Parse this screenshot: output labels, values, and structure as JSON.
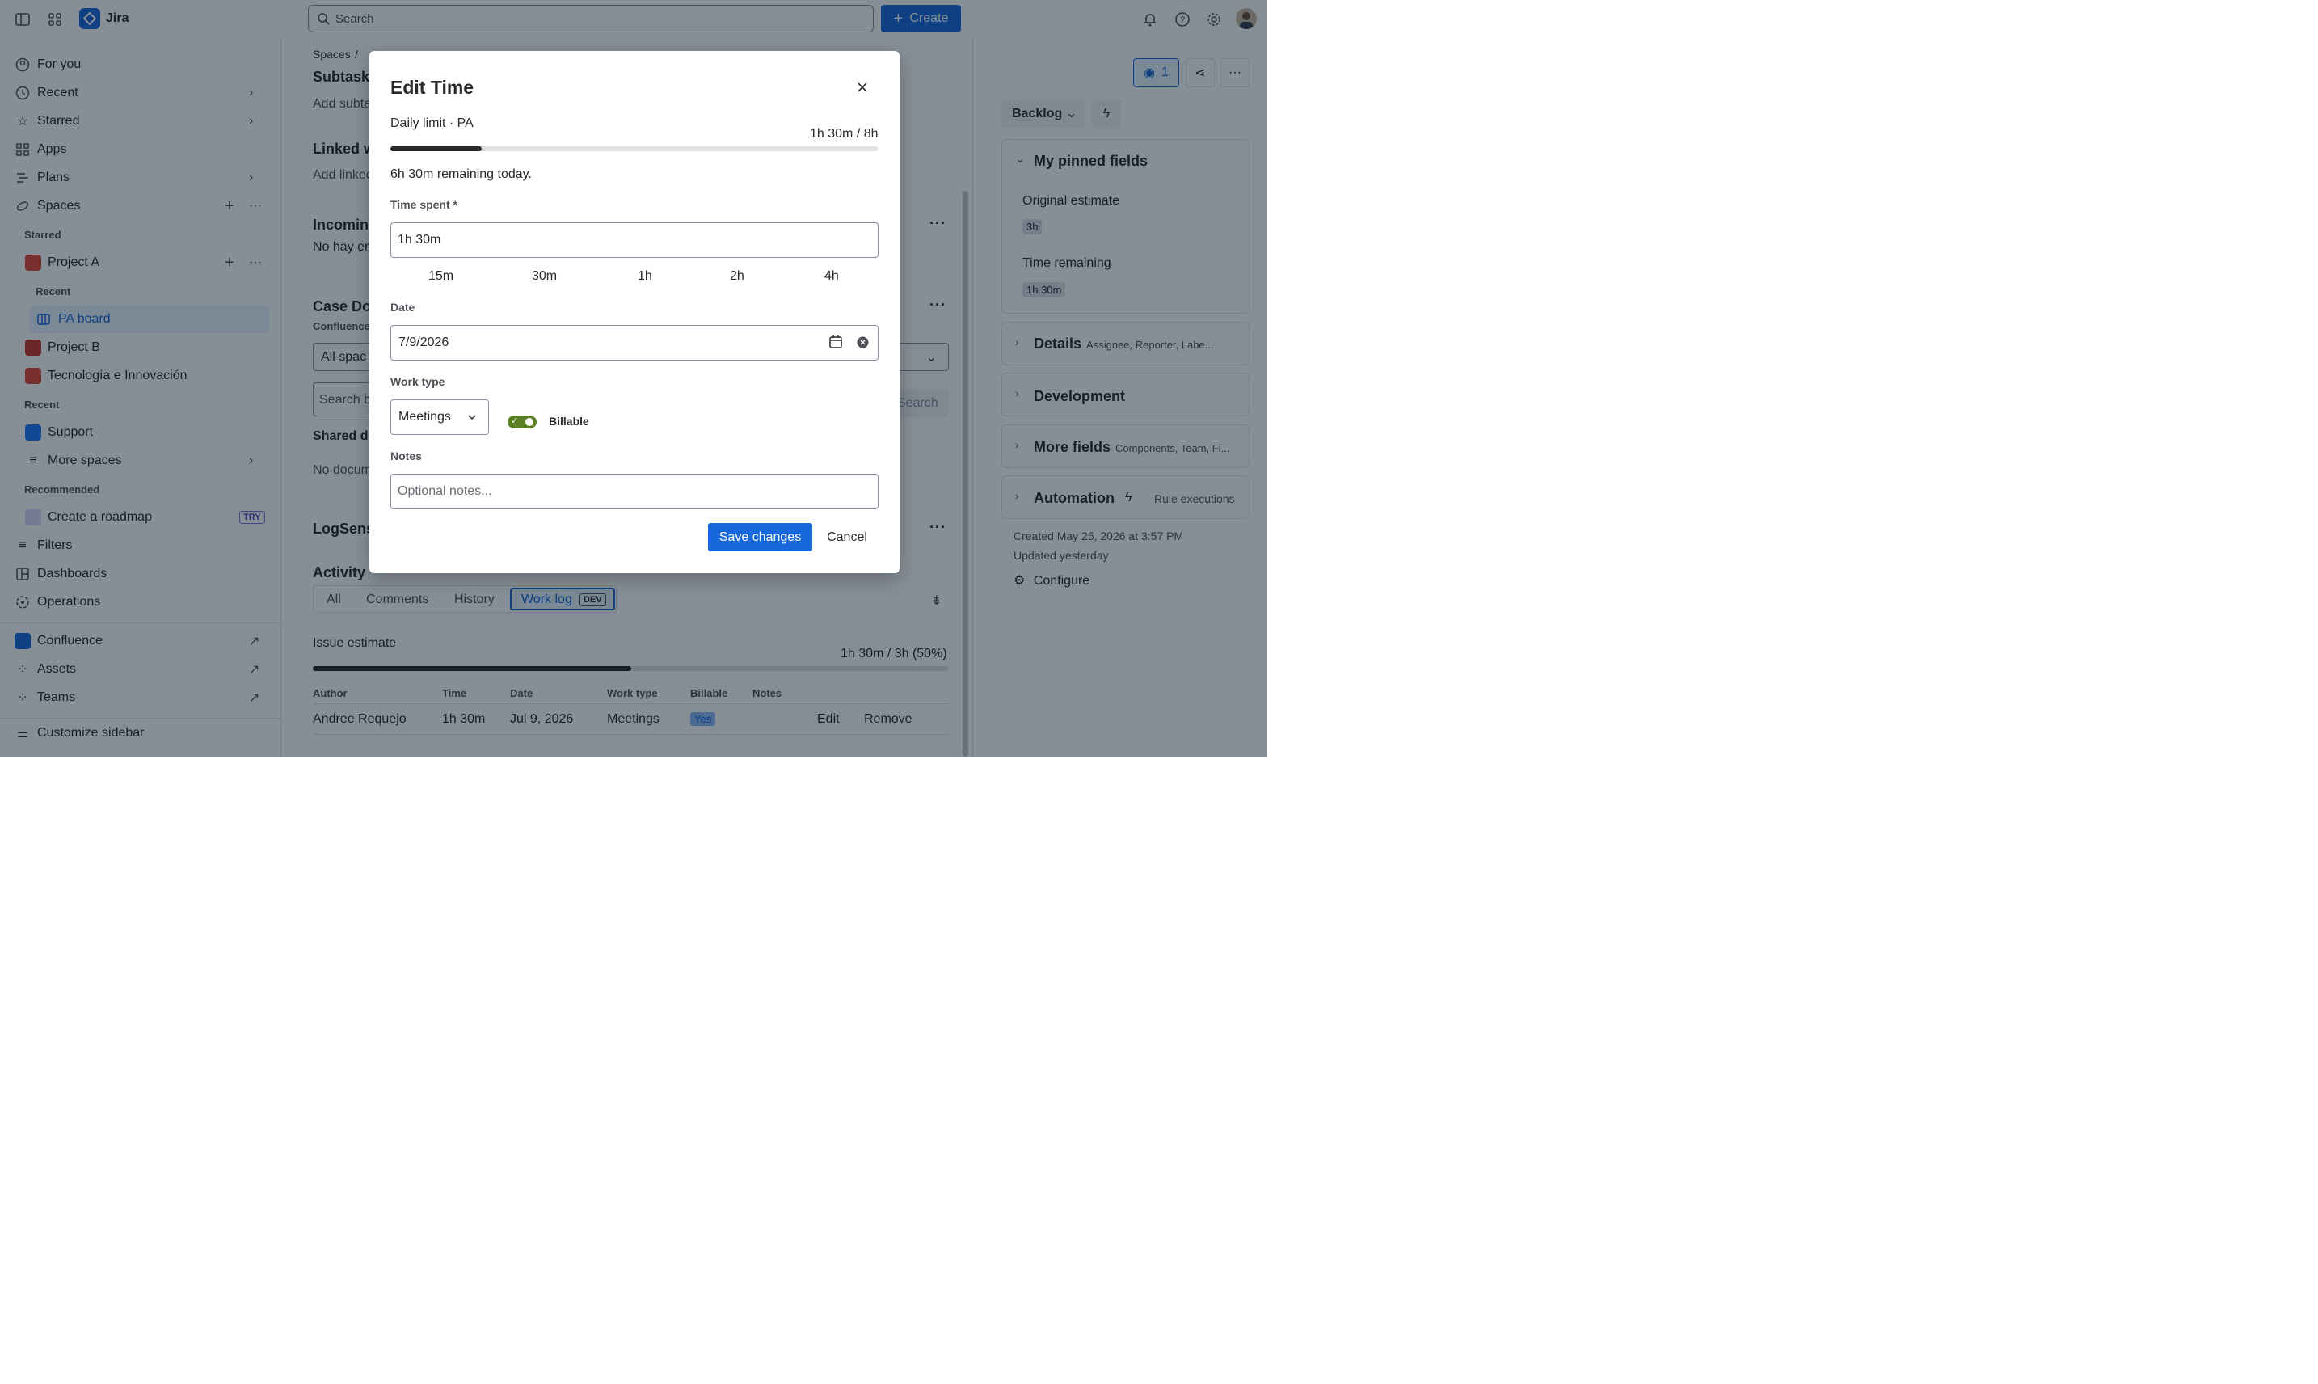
{
  "topbar": {
    "brand": "Jira",
    "search_placeholder": "Search",
    "create_label": "Create"
  },
  "sidebar": {
    "for_you": "For you",
    "recent": "Recent",
    "starred": "Starred",
    "apps": "Apps",
    "plans": "Plans",
    "spaces": "Spaces",
    "starred_section": "Starred",
    "project_a": "Project A",
    "recent_sub": "Recent",
    "pa_board": "PA board",
    "project_b": "Project B",
    "tecnologia": "Tecnología e Innovación",
    "recent_section": "Recent",
    "support": "Support",
    "more_spaces": "More spaces",
    "recommended_section": "Recommended",
    "create_roadmap": "Create a roadmap",
    "try_badge": "TRY",
    "filters": "Filters",
    "dashboards": "Dashboards",
    "operations": "Operations",
    "confluence": "Confluence",
    "assets": "Assets",
    "teams": "Teams",
    "customize": "Customize sidebar"
  },
  "main": {
    "breadcrumb_spaces": "Spaces",
    "breadcrumb_sep": "/",
    "subtasks": "Subtask",
    "add_subtask": "Add subta",
    "linked": "Linked w",
    "add_linked": "Add linked",
    "incoming": "Incomin",
    "no_hay": "No hay er",
    "case_docs": "Case Do",
    "confluence_label": "Confluence",
    "all_spaces": "All spac",
    "search_b": "Search b",
    "search_btn": "Search",
    "shared": "Shared do",
    "no_docs": "No docum",
    "logsense": "LogSens",
    "activity": "Activity",
    "tabs": {
      "all": "All",
      "comments": "Comments",
      "history": "History",
      "work_log": "Work log",
      "dev": "DEV"
    },
    "issue_estimate": "Issue estimate",
    "issue_estimate_value": "1h 30m / 3h (50%)",
    "issue_estimate_progress": 0.5,
    "table": {
      "headers": [
        "Author",
        "Time",
        "Date",
        "Work type",
        "Billable",
        "Notes"
      ],
      "row": {
        "author": "Andree Requejo",
        "time": "1h 30m",
        "date": "Jul 9, 2026",
        "work_type": "Meetings",
        "billable": "Yes",
        "edit": "Edit",
        "remove": "Remove"
      }
    }
  },
  "right": {
    "watchers": "1",
    "status": "Backlog",
    "pinned_title": "My pinned fields",
    "original_estimate_label": "Original estimate",
    "original_estimate": "3h",
    "time_remaining_label": "Time remaining",
    "time_remaining": "1h 30m",
    "details": "Details",
    "details_sub": "Assignee, Reporter, Labe...",
    "development": "Development",
    "more_fields": "More fields",
    "more_fields_sub": "Components, Team, Fi...",
    "automation": "Automation",
    "rule_exec": "Rule executions",
    "created": "Created May 25, 2026 at 3:57 PM",
    "updated": "Updated yesterday",
    "configure": "Configure"
  },
  "modal": {
    "title": "Edit Time",
    "daily_limit_label": "Daily limit · PA",
    "daily_limit_value": "1h 30m / 8h",
    "daily_progress": 0.1875,
    "remaining": "6h 30m remaining today.",
    "time_spent_label": "Time spent *",
    "time_spent_value": "1h 30m",
    "chips": [
      "15m",
      "30m",
      "1h",
      "2h",
      "4h"
    ],
    "date_label": "Date",
    "date_value": "7/9/2026",
    "work_type_label": "Work type",
    "work_type_value": "Meetings",
    "billable_label": "Billable",
    "billable_on": true,
    "notes_label": "Notes",
    "notes_placeholder": "Optional notes...",
    "save_label": "Save changes",
    "cancel_label": "Cancel"
  },
  "colors": {
    "primary": "#1868DB",
    "toggle_on": "#5B7F24",
    "overlay": "rgba(5,21,36,0.48)"
  }
}
